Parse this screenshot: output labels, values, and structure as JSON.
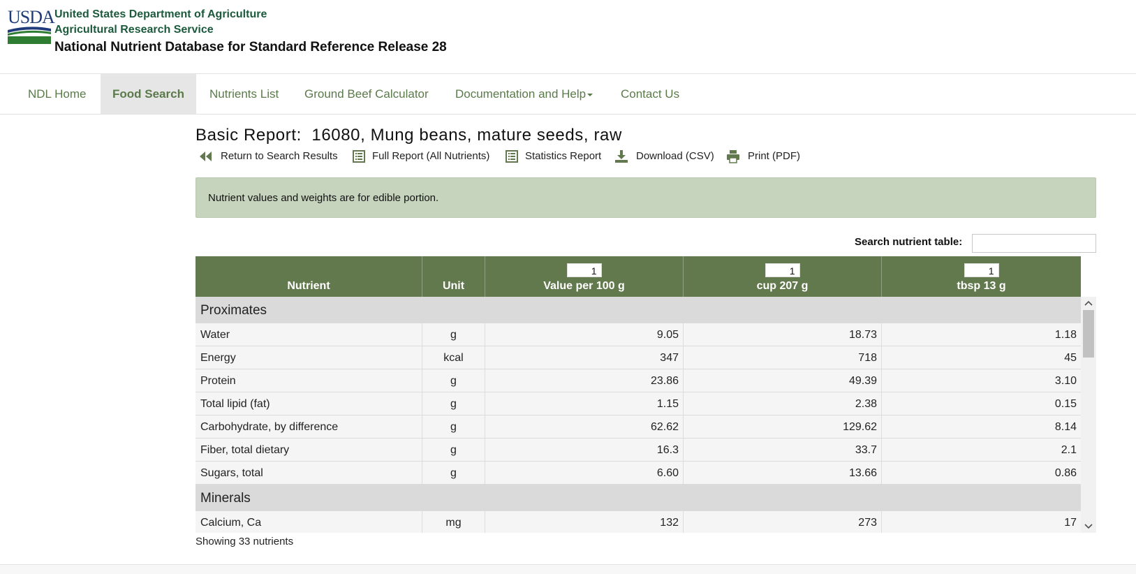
{
  "brand": {
    "logo_text": "USDA",
    "agency_line1": "United States Department of Agriculture",
    "agency_line2": "Agricultural Research Service",
    "database_title": "National Nutrient Database for Standard Reference Release 28",
    "colors": {
      "agency_text": "#1c5a3c",
      "logo_blue": "#1f3b7a",
      "logo_green": "#2e7d32"
    }
  },
  "nav": {
    "items": [
      {
        "label": "NDL Home",
        "active": false
      },
      {
        "label": "Food Search",
        "active": true
      },
      {
        "label": "Nutrients List",
        "active": false
      },
      {
        "label": "Ground Beef Calculator",
        "active": false
      },
      {
        "label": "Documentation and Help",
        "active": false,
        "dropdown": true
      },
      {
        "label": "Contact Us",
        "active": false
      }
    ],
    "colors": {
      "link": "#5b7a4a",
      "active_bg": "#e6e6e6"
    }
  },
  "report": {
    "title": "Basic Report:  16080, Mung beans, mature seeds, raw",
    "actions": [
      {
        "icon": "rewind-icon",
        "label": "Return to Search Results"
      },
      {
        "icon": "list-icon",
        "label": "Full Report (All Nutrients)"
      },
      {
        "icon": "list-icon",
        "label": "Statistics Report"
      },
      {
        "icon": "download-icon",
        "label": "Download (CSV)"
      },
      {
        "icon": "printer-icon",
        "label": "Print (PDF)"
      }
    ]
  },
  "notice": {
    "text": "Nutrient values and weights are for edible portion.",
    "color": "#c6d4bd"
  },
  "search": {
    "label": "Search nutrient table:",
    "value": "",
    "placeholder": ""
  },
  "table": {
    "header_color": "#62784d",
    "columns": {
      "nutrient": "Nutrient",
      "unit": "Unit",
      "per100": {
        "qty": "1",
        "label": "Value per 100 g"
      },
      "cup": {
        "qty": "1",
        "label": "cup 207 g"
      },
      "tbsp": {
        "qty": "1",
        "label": "tbsp 13 g"
      }
    },
    "groups": [
      {
        "name": "Proximates",
        "rows": [
          {
            "nutrient": "Water",
            "unit": "g",
            "per100": "9.05",
            "cup": "18.73",
            "tbsp": "1.18"
          },
          {
            "nutrient": "Energy",
            "unit": "kcal",
            "per100": "347",
            "cup": "718",
            "tbsp": "45"
          },
          {
            "nutrient": "Protein",
            "unit": "g",
            "per100": "23.86",
            "cup": "49.39",
            "tbsp": "3.10"
          },
          {
            "nutrient": "Total lipid (fat)",
            "unit": "g",
            "per100": "1.15",
            "cup": "2.38",
            "tbsp": "0.15"
          },
          {
            "nutrient": "Carbohydrate, by difference",
            "unit": "g",
            "per100": "62.62",
            "cup": "129.62",
            "tbsp": "8.14"
          },
          {
            "nutrient": "Fiber, total dietary",
            "unit": "g",
            "per100": "16.3",
            "cup": "33.7",
            "tbsp": "2.1"
          },
          {
            "nutrient": "Sugars, total",
            "unit": "g",
            "per100": "6.60",
            "cup": "13.66",
            "tbsp": "0.86"
          }
        ]
      },
      {
        "name": "Minerals",
        "rows": [
          {
            "nutrient": "Calcium, Ca",
            "unit": "mg",
            "per100": "132",
            "cup": "273",
            "tbsp": "17"
          }
        ]
      }
    ],
    "footer": "Showing 33 nutrients"
  }
}
